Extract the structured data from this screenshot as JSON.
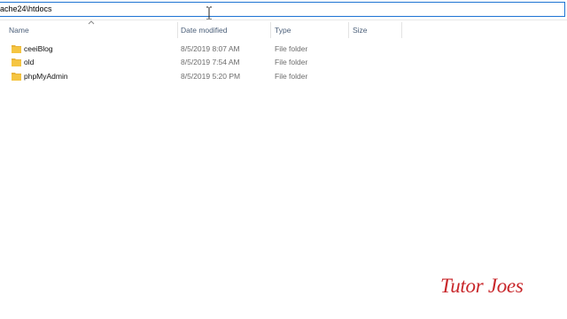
{
  "address_bar": {
    "path": "ache24\\htdocs"
  },
  "columns": [
    {
      "key": "name",
      "label": "Name"
    },
    {
      "key": "date",
      "label": "Date modified"
    },
    {
      "key": "type",
      "label": "Type"
    },
    {
      "key": "size",
      "label": "Size"
    }
  ],
  "files": [
    {
      "name": "ceeiBlog",
      "date": "8/5/2019 8:07 AM",
      "type": "File folder",
      "icon": "folder-icon"
    },
    {
      "name": "old",
      "date": "8/5/2019 7:54 AM",
      "type": "File folder",
      "icon": "folder-icon"
    },
    {
      "name": "phpMyAdmin",
      "date": "8/5/2019 5:20 PM",
      "type": "File folder",
      "icon": "folder-icon"
    }
  ],
  "watermark": {
    "text": "Tutor Joes"
  },
  "colors": {
    "accent": "#1e74d3",
    "folder": "#f5c542",
    "watermark": "#c8262a",
    "header_text": "#4c607a"
  }
}
